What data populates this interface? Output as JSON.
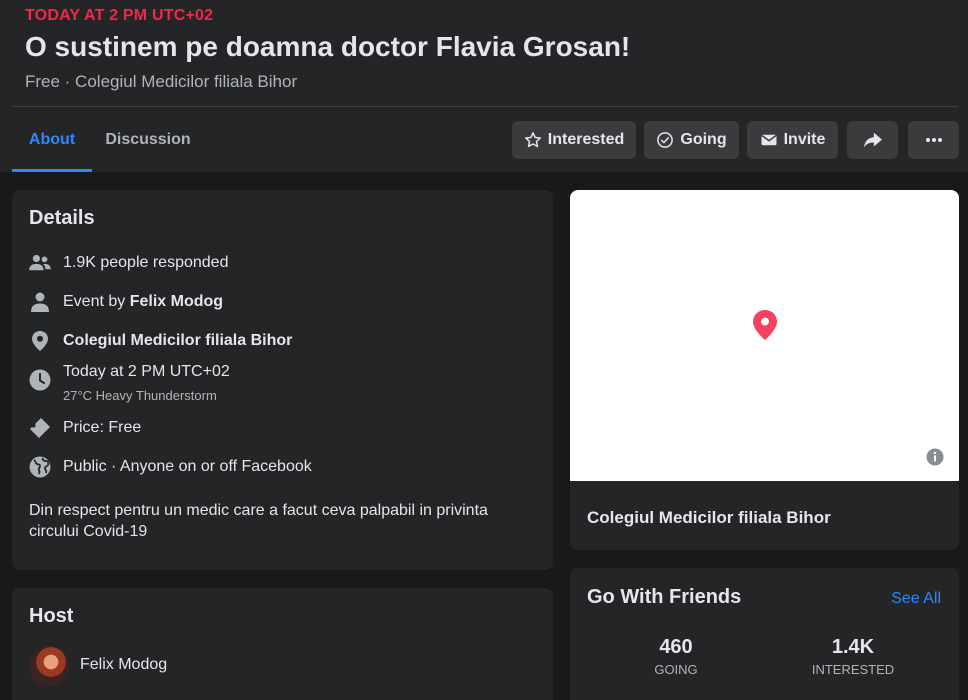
{
  "event": {
    "date": "TODAY AT 2 PM UTC+02",
    "title": "O sustinem pe doamna doctor Flavia Grosan!",
    "subtitle": "Free · Colegiul Medicilor filiala Bihor"
  },
  "tabs": [
    {
      "label": "About",
      "active": true
    },
    {
      "label": "Discussion",
      "active": false
    }
  ],
  "actions": {
    "interested": "Interested",
    "going": "Going",
    "invite": "Invite"
  },
  "details": {
    "title": "Details",
    "responded": "1.9K people responded",
    "event_by_prefix": "Event by ",
    "event_by_name": "Felix Modog",
    "location": "Colegiul Medicilor filiala Bihor",
    "time": "Today at 2 PM UTC+02",
    "weather": "27°C Heavy Thunderstorm",
    "price": "Price: Free",
    "privacy": "Public · Anyone on or off Facebook",
    "description": "Din respect pentru un medic care a facut ceva palpabil in privinta circului Covid-19"
  },
  "map": {
    "location": "Colegiul Medicilor filiala Bihor",
    "pin_color": "#f3425f"
  },
  "host": {
    "title": "Host",
    "name": "Felix Modog"
  },
  "friends": {
    "title": "Go With Friends",
    "see_all": "See All",
    "going_count": "460",
    "going_label": "GOING",
    "interested_count": "1.4K",
    "interested_label": "INTERESTED"
  },
  "colors": {
    "accent": "#2d88ff",
    "date_red": "#f02849",
    "background": "#18191a",
    "card": "#242526"
  }
}
